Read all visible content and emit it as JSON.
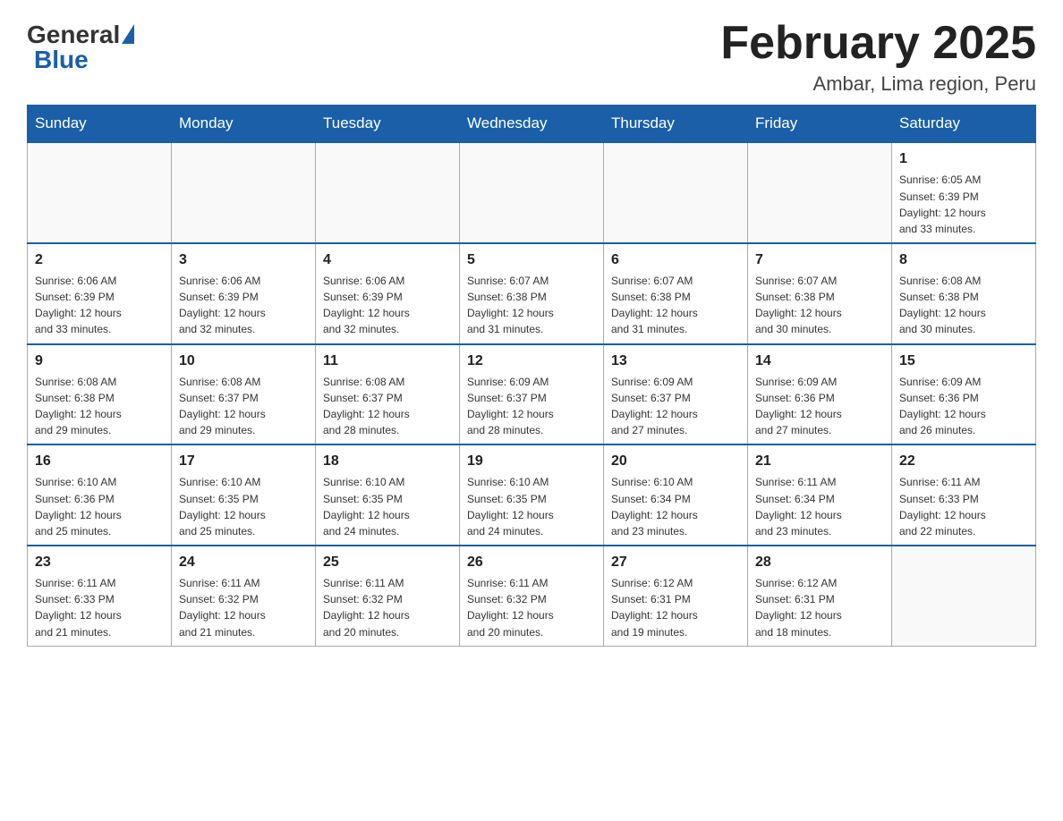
{
  "header": {
    "logo_general": "General",
    "logo_blue": "Blue",
    "month_title": "February 2025",
    "location": "Ambar, Lima region, Peru"
  },
  "weekdays": [
    "Sunday",
    "Monday",
    "Tuesday",
    "Wednesday",
    "Thursday",
    "Friday",
    "Saturday"
  ],
  "weeks": [
    [
      {
        "day": "",
        "info": ""
      },
      {
        "day": "",
        "info": ""
      },
      {
        "day": "",
        "info": ""
      },
      {
        "day": "",
        "info": ""
      },
      {
        "day": "",
        "info": ""
      },
      {
        "day": "",
        "info": ""
      },
      {
        "day": "1",
        "info": "Sunrise: 6:05 AM\nSunset: 6:39 PM\nDaylight: 12 hours\nand 33 minutes."
      }
    ],
    [
      {
        "day": "2",
        "info": "Sunrise: 6:06 AM\nSunset: 6:39 PM\nDaylight: 12 hours\nand 33 minutes."
      },
      {
        "day": "3",
        "info": "Sunrise: 6:06 AM\nSunset: 6:39 PM\nDaylight: 12 hours\nand 32 minutes."
      },
      {
        "day": "4",
        "info": "Sunrise: 6:06 AM\nSunset: 6:39 PM\nDaylight: 12 hours\nand 32 minutes."
      },
      {
        "day": "5",
        "info": "Sunrise: 6:07 AM\nSunset: 6:38 PM\nDaylight: 12 hours\nand 31 minutes."
      },
      {
        "day": "6",
        "info": "Sunrise: 6:07 AM\nSunset: 6:38 PM\nDaylight: 12 hours\nand 31 minutes."
      },
      {
        "day": "7",
        "info": "Sunrise: 6:07 AM\nSunset: 6:38 PM\nDaylight: 12 hours\nand 30 minutes."
      },
      {
        "day": "8",
        "info": "Sunrise: 6:08 AM\nSunset: 6:38 PM\nDaylight: 12 hours\nand 30 minutes."
      }
    ],
    [
      {
        "day": "9",
        "info": "Sunrise: 6:08 AM\nSunset: 6:38 PM\nDaylight: 12 hours\nand 29 minutes."
      },
      {
        "day": "10",
        "info": "Sunrise: 6:08 AM\nSunset: 6:37 PM\nDaylight: 12 hours\nand 29 minutes."
      },
      {
        "day": "11",
        "info": "Sunrise: 6:08 AM\nSunset: 6:37 PM\nDaylight: 12 hours\nand 28 minutes."
      },
      {
        "day": "12",
        "info": "Sunrise: 6:09 AM\nSunset: 6:37 PM\nDaylight: 12 hours\nand 28 minutes."
      },
      {
        "day": "13",
        "info": "Sunrise: 6:09 AM\nSunset: 6:37 PM\nDaylight: 12 hours\nand 27 minutes."
      },
      {
        "day": "14",
        "info": "Sunrise: 6:09 AM\nSunset: 6:36 PM\nDaylight: 12 hours\nand 27 minutes."
      },
      {
        "day": "15",
        "info": "Sunrise: 6:09 AM\nSunset: 6:36 PM\nDaylight: 12 hours\nand 26 minutes."
      }
    ],
    [
      {
        "day": "16",
        "info": "Sunrise: 6:10 AM\nSunset: 6:36 PM\nDaylight: 12 hours\nand 25 minutes."
      },
      {
        "day": "17",
        "info": "Sunrise: 6:10 AM\nSunset: 6:35 PM\nDaylight: 12 hours\nand 25 minutes."
      },
      {
        "day": "18",
        "info": "Sunrise: 6:10 AM\nSunset: 6:35 PM\nDaylight: 12 hours\nand 24 minutes."
      },
      {
        "day": "19",
        "info": "Sunrise: 6:10 AM\nSunset: 6:35 PM\nDaylight: 12 hours\nand 24 minutes."
      },
      {
        "day": "20",
        "info": "Sunrise: 6:10 AM\nSunset: 6:34 PM\nDaylight: 12 hours\nand 23 minutes."
      },
      {
        "day": "21",
        "info": "Sunrise: 6:11 AM\nSunset: 6:34 PM\nDaylight: 12 hours\nand 23 minutes."
      },
      {
        "day": "22",
        "info": "Sunrise: 6:11 AM\nSunset: 6:33 PM\nDaylight: 12 hours\nand 22 minutes."
      }
    ],
    [
      {
        "day": "23",
        "info": "Sunrise: 6:11 AM\nSunset: 6:33 PM\nDaylight: 12 hours\nand 21 minutes."
      },
      {
        "day": "24",
        "info": "Sunrise: 6:11 AM\nSunset: 6:32 PM\nDaylight: 12 hours\nand 21 minutes."
      },
      {
        "day": "25",
        "info": "Sunrise: 6:11 AM\nSunset: 6:32 PM\nDaylight: 12 hours\nand 20 minutes."
      },
      {
        "day": "26",
        "info": "Sunrise: 6:11 AM\nSunset: 6:32 PM\nDaylight: 12 hours\nand 20 minutes."
      },
      {
        "day": "27",
        "info": "Sunrise: 6:12 AM\nSunset: 6:31 PM\nDaylight: 12 hours\nand 19 minutes."
      },
      {
        "day": "28",
        "info": "Sunrise: 6:12 AM\nSunset: 6:31 PM\nDaylight: 12 hours\nand 18 minutes."
      },
      {
        "day": "",
        "info": ""
      }
    ]
  ]
}
